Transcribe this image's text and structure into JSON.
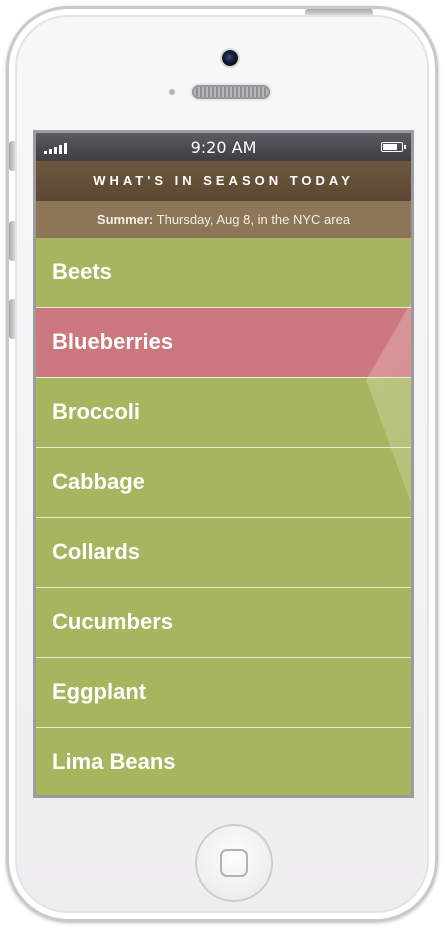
{
  "status_bar": {
    "time": "9:20 AM",
    "signal_bars": 5,
    "battery_level": 0.85
  },
  "header": {
    "title": "WHAT'S IN SEASON TODAY"
  },
  "season": {
    "label": "Summer:",
    "detail": "Thursday, Aug 8, in the NYC area"
  },
  "colors": {
    "item_green": "#a5b65f",
    "item_red": "#cc767d",
    "header_brown": "#5f4b34",
    "season_tan": "#8c7657"
  },
  "produce": [
    {
      "label": "Beets",
      "color": "#a5b65f"
    },
    {
      "label": "Blueberries",
      "color": "#cc767d"
    },
    {
      "label": "Broccoli",
      "color": "#a5b65f"
    },
    {
      "label": "Cabbage",
      "color": "#a5b65f"
    },
    {
      "label": "Collards",
      "color": "#a5b65f"
    },
    {
      "label": "Cucumbers",
      "color": "#a5b65f"
    },
    {
      "label": "Eggplant",
      "color": "#a5b65f"
    },
    {
      "label": "Lima Beans",
      "color": "#a5b65f"
    }
  ]
}
